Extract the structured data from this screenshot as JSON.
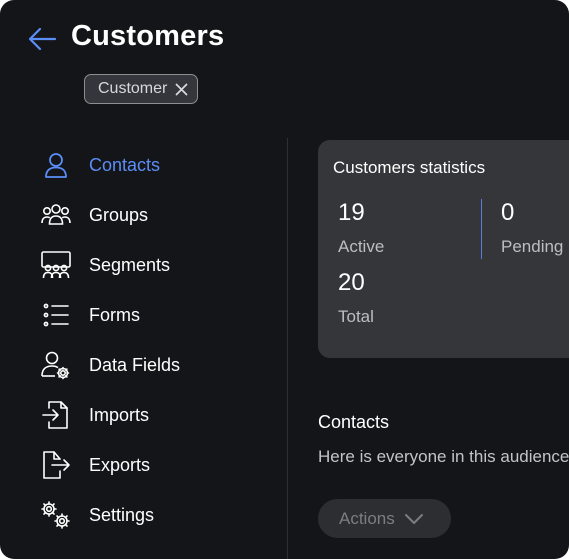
{
  "header": {
    "title": "Customers",
    "back_icon": "arrow-left-icon",
    "tag": {
      "label": "Customer",
      "close_icon": "close-icon"
    }
  },
  "sidebar": {
    "items": [
      {
        "label": "Contacts",
        "icon": "user-icon",
        "active": true
      },
      {
        "label": "Groups",
        "icon": "users-group-icon",
        "active": false
      },
      {
        "label": "Segments",
        "icon": "audience-segments-icon",
        "active": false
      },
      {
        "label": "Forms",
        "icon": "list-icon",
        "active": false
      },
      {
        "label": "Data Fields",
        "icon": "user-settings-icon",
        "active": false
      },
      {
        "label": "Imports",
        "icon": "import-icon",
        "active": false
      },
      {
        "label": "Exports",
        "icon": "export-icon",
        "active": false
      },
      {
        "label": "Settings",
        "icon": "gears-icon",
        "active": false
      }
    ]
  },
  "stats": {
    "title": "Customers statistics",
    "active_value": "19",
    "active_label": "Active",
    "pending_value": "0",
    "pending_label": "Pending",
    "total_value": "20",
    "total_label": "Total"
  },
  "contacts_section": {
    "title": "Contacts",
    "description": "Here is everyone in this audience",
    "actions_label": "Actions",
    "actions_icon": "chevron-down-icon"
  },
  "colors": {
    "background": "#141518",
    "accent": "#5b8df7",
    "card": "#35363a"
  }
}
